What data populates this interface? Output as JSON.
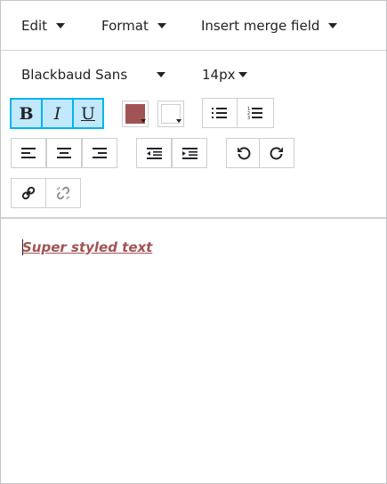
{
  "menubar": {
    "edit_label": "Edit",
    "format_label": "Format",
    "merge_label": "Insert merge field"
  },
  "toolbar": {
    "font_family": "Blackbaud Sans",
    "font_size": "14px",
    "bold_label": "B",
    "italic_label": "I",
    "underline_label": "U",
    "text_color": "#a25353",
    "background_color": "#ffffff",
    "active_accent": "#00b4f1",
    "active_fill": "#c1e8fb"
  },
  "content": {
    "text": "Super styled text",
    "text_color": "#a25353"
  }
}
